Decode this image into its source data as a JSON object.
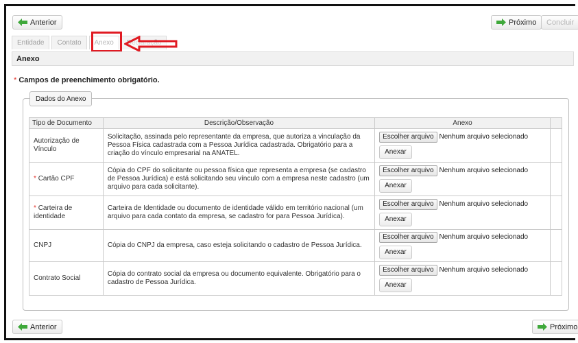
{
  "nav": {
    "previous_label": "Anterior",
    "next_label": "Próximo",
    "finish_label": "Concluir"
  },
  "tabs": [
    {
      "label": "Entidade",
      "active": false
    },
    {
      "label": "Contato",
      "active": false
    },
    {
      "label": "Anexo",
      "active": true
    },
    {
      "label": "Declaração",
      "active": false
    }
  ],
  "section": {
    "title": "Anexo",
    "required_mark": "*",
    "required_note": "Campos de preenchimento obrigatório.",
    "fieldset_legend": "Dados do Anexo"
  },
  "table": {
    "headers": [
      "Tipo de Documento",
      "Descrição/Observação",
      "Anexo"
    ],
    "file_button_label": "Escolher arquivo",
    "file_status": "Nenhum arquivo selecionado",
    "attach_label": "Anexar",
    "rows": [
      {
        "required": false,
        "type": "Autorização de Vínculo",
        "description": "Solicitação, assinada pelo representante da empresa, que autoriza a vinculação da Pessoa Física cadastrada com a Pessoa Jurídica cadastrada. Obrigatório para a criação do vínculo empresarial na ANATEL."
      },
      {
        "required": true,
        "type": "Cartão CPF",
        "description": "Cópia do CPF do solicitante ou pessoa física que representa a empresa (se cadastro de Pessoa Jurídica) e está solicitando seu vínculo com a empresa neste cadastro (um arquivo para cada solicitante)."
      },
      {
        "required": true,
        "type": "Carteira de identidade",
        "description": "Carteira de Identidade ou documento de identidade válido em território nacional (um arquivo para cada contato da empresa, se cadastro for para Pessoa Jurídica)."
      },
      {
        "required": false,
        "type": "CNPJ",
        "description": "Cópia do CNPJ da empresa, caso esteja solicitando o cadastro de Pessoa Jurídica."
      },
      {
        "required": false,
        "type": "Contrato Social",
        "description": "Cópia do contrato social da empresa ou documento equivalente. Obrigatório para o cadastro de Pessoa Jurídica."
      }
    ]
  },
  "colors": {
    "arrow_green": "#3ea83a",
    "highlight_red": "#e01a22",
    "required_red": "#e2332b"
  }
}
